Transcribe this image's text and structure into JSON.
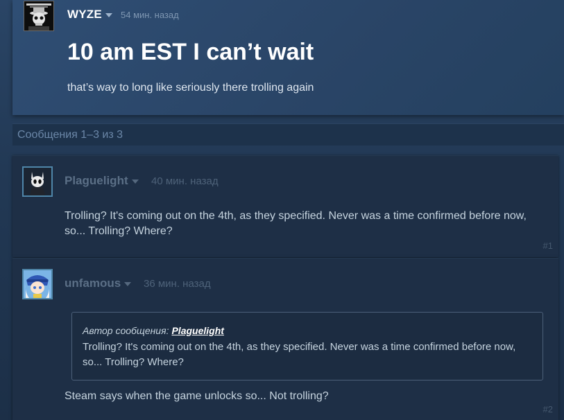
{
  "original_post": {
    "author": "WYZE",
    "time": "54 мин. назад",
    "title": "10 am EST I can’t wait",
    "body": "that’s way to long like seriously there trolling again",
    "avatar_label": "WYZE avatar"
  },
  "messages_count": "Сообщения 1–3 из 3",
  "replies": [
    {
      "author": "Plaguelight",
      "time": "40 мин. назад",
      "body": "Trolling? It's coming out on the 4th, as they specified. Never was a time confirmed before now, so... Trolling? Where?",
      "number": "#1"
    },
    {
      "author": "unfamous",
      "time": "36 мин. назад",
      "quote": {
        "prefix": "Автор сообщения:",
        "author": "Plaguelight",
        "body": "Trolling? It's coming out on the 4th, as they specified. Never was a time confirmed before now, so... Trolling? Where?"
      },
      "body": "Steam says when the game unlocks so... Not trolling?",
      "number": "#2"
    }
  ],
  "icons": {
    "author_dropdown": "chevron-down-icon"
  },
  "colors": {
    "background": "#1f3147",
    "op_panel": "#2a4567",
    "reply_panel": "#1e2f46",
    "text_light": "#c6d4df",
    "muted_author": "#5b6f86"
  }
}
